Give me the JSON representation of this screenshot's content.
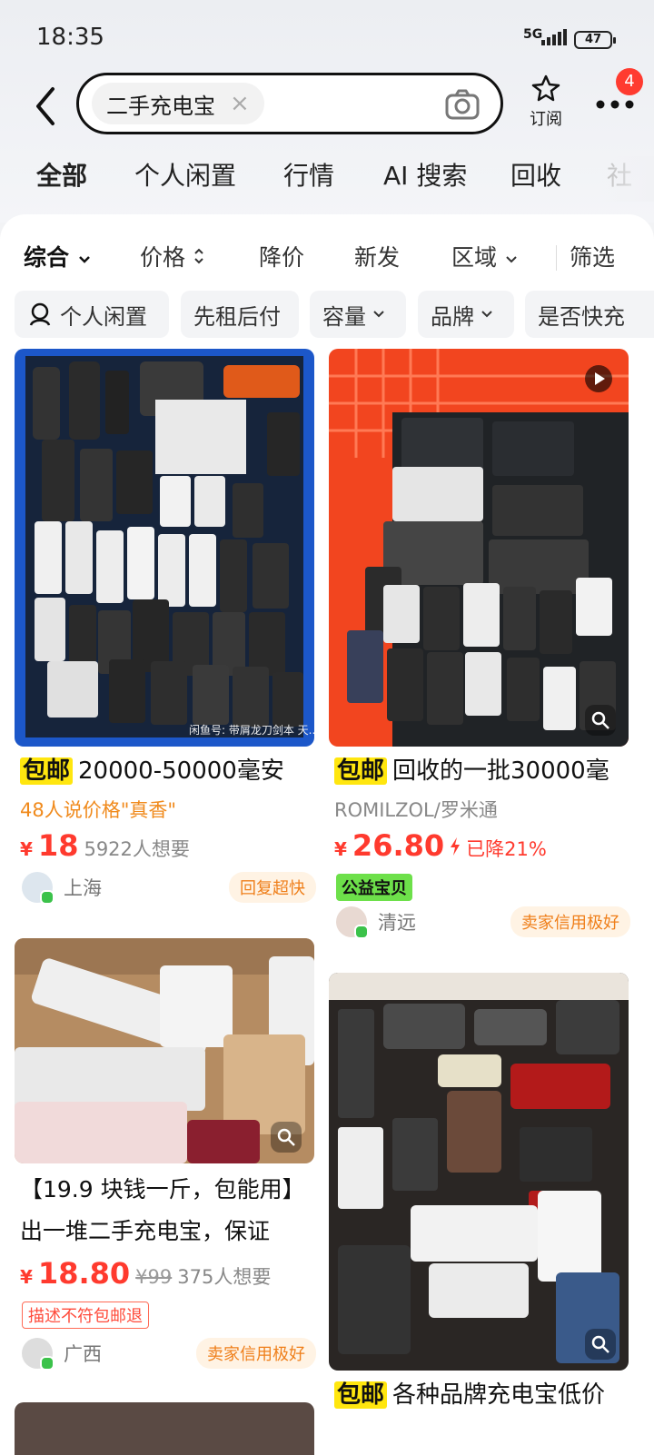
{
  "status_bar": {
    "time": "18:35",
    "network": "5G",
    "battery": "47"
  },
  "header": {
    "search_chip": "二手充电宝",
    "clear_glyph": "×",
    "subscribe_label": "订阅",
    "more_badge": "4"
  },
  "tabs": [
    "全部",
    "个人闲置",
    "行情",
    "AI 搜索",
    "回收",
    "社"
  ],
  "sort_bar": [
    "综合",
    "价格",
    "降价",
    "新发",
    "区域",
    "筛选"
  ],
  "filters": [
    "个人闲置",
    "先租后付",
    "容量",
    "品牌",
    "是否快充"
  ],
  "colors": {
    "accent_yellow": "#ffe60f",
    "price_red": "#ff3a2e",
    "orange_hint": "#f08a1c",
    "green_tag": "#6de04a"
  },
  "products": [
    {
      "tag": "包邮",
      "title": "20000-50000毫安",
      "hint": "48人说价格\"真香\"",
      "currency": "¥",
      "price": "18",
      "want": "5922人想要",
      "location": "上海",
      "seller_badge": "回复超快",
      "watermark": "闲鱼号: 带屑龙刀剑本 天..."
    },
    {
      "tag": "包邮",
      "title": "回收的一批30000毫",
      "brand": "ROMILZOL/罗米通",
      "currency": "¥",
      "price": "26.80",
      "drop": "已降21%",
      "charity_tag": "公益宝贝",
      "location": "清远",
      "seller_badge": "卖家信用极好"
    },
    {
      "title_line1": "【19.9 块钱一斤，包能用】",
      "title_line2": "出一堆二手充电宝，保证",
      "currency": "¥",
      "price": "18.80",
      "original_price": "¥99",
      "want": "375人想要",
      "refund_tag": "描述不符包邮退",
      "location": "广西",
      "seller_badge": "卖家信用极好"
    },
    {
      "tag": "包邮",
      "title": "各种品牌充电宝低价"
    }
  ]
}
